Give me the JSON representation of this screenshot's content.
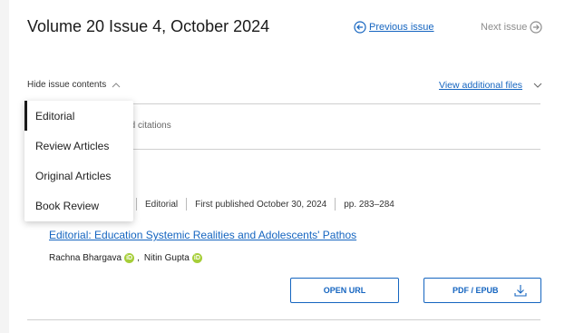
{
  "issue": {
    "title": "Volume 20 Issue 4, October 2024",
    "previous_label": "Previous issue",
    "next_label": "Next issue"
  },
  "toolbar": {
    "hide_contents_label": "Hide issue contents",
    "view_files_label": "View additional files"
  },
  "citations": {
    "selected_text": "elected citations"
  },
  "dropdown": {
    "items": [
      {
        "label": "Editorial",
        "active": true
      },
      {
        "label": "Review Articles",
        "active": false
      },
      {
        "label": "Original Articles",
        "active": false
      },
      {
        "label": "Book Review",
        "active": false
      }
    ]
  },
  "article": {
    "type": "Editorial",
    "published": "First published October 30, 2024",
    "pages": "pp. 283–284",
    "title": "Editorial: Education Systemic Realities and Adolescents' Pathos",
    "authors": [
      {
        "name": "Rachna Bhargava",
        "separator": ","
      },
      {
        "name": "Nitin Gupta",
        "separator": ""
      }
    ],
    "open_url_label": "OPEN URL",
    "pdf_label": "PDF / EPUB"
  },
  "colors": {
    "link": "#1565c0",
    "orcid": "#a6ce39"
  },
  "icons": {
    "previous": "arrow-left-circle-icon",
    "next": "arrow-right-circle-icon",
    "hide": "chevron-up-icon",
    "view_files": "chevron-down-icon",
    "orcid": "orcid-icon",
    "download": "download-icon"
  }
}
